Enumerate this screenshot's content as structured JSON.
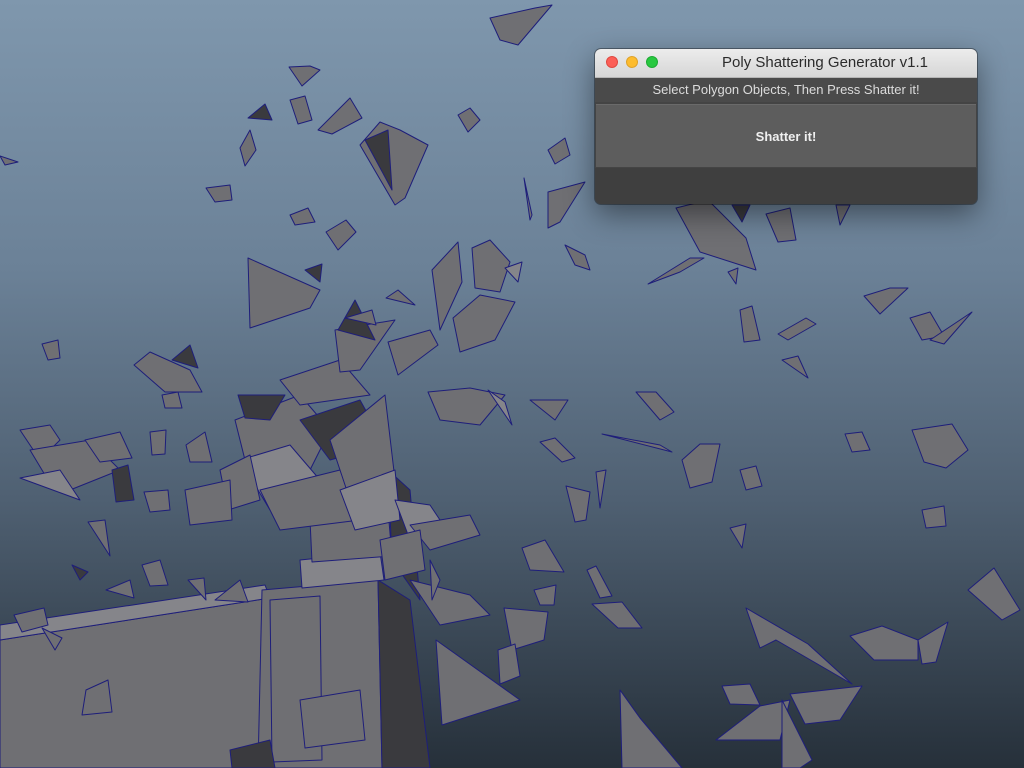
{
  "window": {
    "title": "Poly Shattering Generator v1.1",
    "controls": [
      "close-icon",
      "minimize-icon",
      "maximize-icon"
    ]
  },
  "dialog": {
    "instruction": "Select Polygon Objects, Then Press Shatter it!",
    "shatter_button": "Shatter it!"
  },
  "colors": {
    "close": "#fc5f57",
    "minimize": "#fdbc2e",
    "maximize": "#28c840",
    "wireframe": "#1e1e7a",
    "fragment": "#6f6f73"
  }
}
